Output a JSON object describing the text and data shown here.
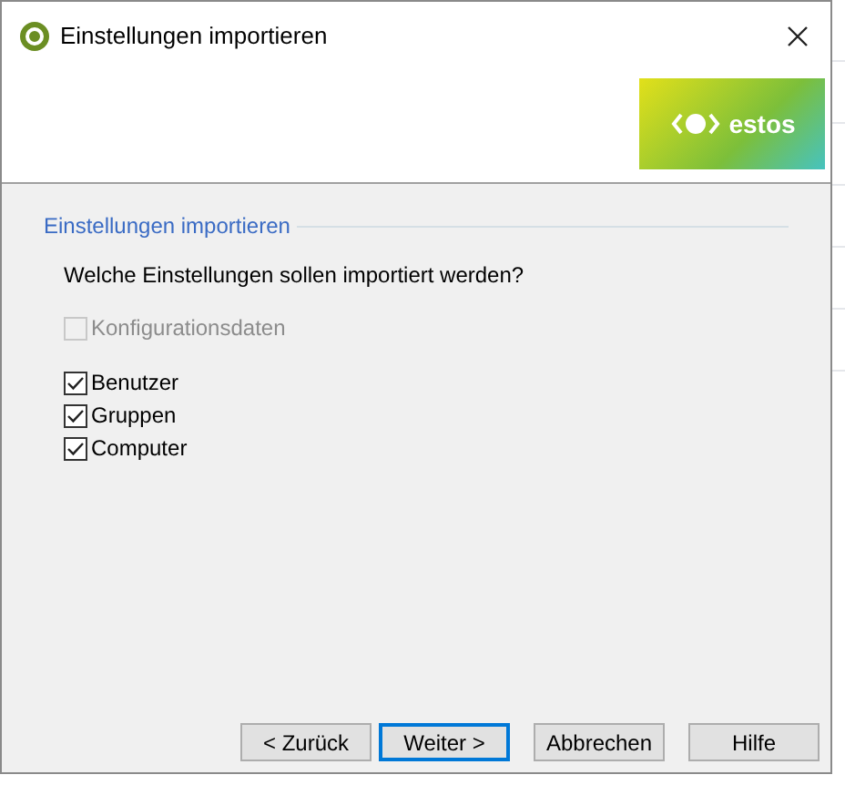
{
  "window": {
    "title": "Einstellungen importieren"
  },
  "logo": {
    "text": "estos"
  },
  "section": {
    "title": "Einstellungen importieren",
    "question": "Welche Einstellungen sollen importiert werden?"
  },
  "option_groups": [
    {
      "items": [
        {
          "label": "Konfigurationsdaten",
          "checked": false,
          "disabled": true
        }
      ]
    },
    {
      "items": [
        {
          "label": "Benutzer",
          "checked": true,
          "disabled": false
        },
        {
          "label": "Gruppen",
          "checked": true,
          "disabled": false
        },
        {
          "label": "Computer",
          "checked": true,
          "disabled": false
        }
      ]
    }
  ],
  "buttons": [
    {
      "label": "< Zurück",
      "default": false
    },
    {
      "label": "Weiter >",
      "default": true
    },
    {
      "label": "Abbrechen",
      "default": false
    },
    {
      "label": "Hilfe",
      "default": false
    }
  ]
}
